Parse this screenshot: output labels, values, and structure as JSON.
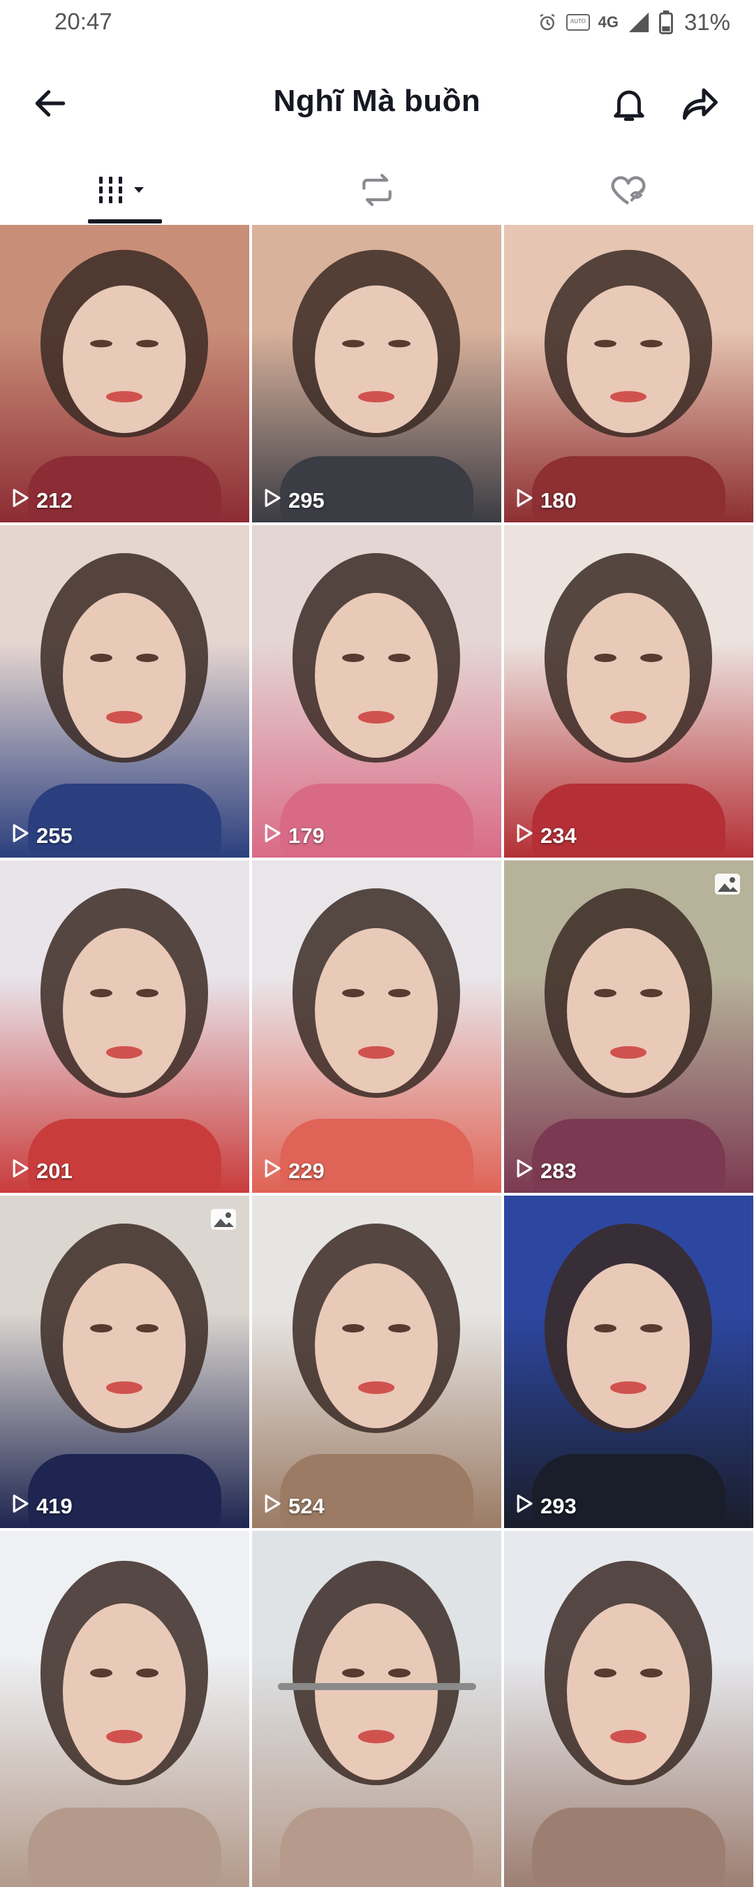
{
  "status": {
    "time": "20:47",
    "network": "4G",
    "auto_label": "AUTO",
    "battery": "31%"
  },
  "header": {
    "title": "Nghĩ Mà  buồn",
    "back_icon": "arrow-left-icon",
    "bell_icon": "bell-icon",
    "share_icon": "share-arrow-icon"
  },
  "tabs": [
    {
      "name": "videos",
      "icon": "grid-columns-icon",
      "selected": true
    },
    {
      "name": "reposts",
      "icon": "repost-icon",
      "selected": false
    },
    {
      "name": "liked",
      "icon": "hidden-heart-icon",
      "selected": false
    }
  ],
  "grid": {
    "items": [
      {
        "views": "212",
        "photo": false,
        "bg": "#8c2c34",
        "top": "#c98e78"
      },
      {
        "views": "295",
        "photo": false,
        "bg": "#3b3c44",
        "top": "#d9b29c"
      },
      {
        "views": "180",
        "photo": false,
        "bg": "#8d2f33",
        "top": "#e6c5b2"
      },
      {
        "views": "255",
        "photo": false,
        "bg": "#2b3f7e",
        "top": "#e6d6d0"
      },
      {
        "views": "179",
        "photo": false,
        "bg": "#d96a86",
        "top": "#e4d6d4"
      },
      {
        "views": "234",
        "photo": false,
        "bg": "#b43036",
        "top": "#ece3df"
      },
      {
        "views": "201",
        "photo": false,
        "bg": "#c93c3c",
        "top": "#e8e4ea"
      },
      {
        "views": "229",
        "photo": false,
        "bg": "#df6356",
        "top": "#e9e6ea"
      },
      {
        "views": "283",
        "photo": true,
        "bg": "#7c3a52",
        "top": "#b7b29a"
      },
      {
        "views": "419",
        "photo": true,
        "bg": "#1e2550",
        "top": "#dcd6d0"
      },
      {
        "views": "524",
        "photo": false,
        "bg": "#9b7b64",
        "top": "#e7e5e3"
      },
      {
        "views": "293",
        "photo": false,
        "bg": "#1a1d2a",
        "top": "#2d47a0"
      },
      {
        "views": "",
        "photo": false,
        "bg": "#b39a8b",
        "top": "#eef0f3"
      },
      {
        "views": "",
        "photo": false,
        "bg": "#b69b8c",
        "top": "#dfe3e6"
      },
      {
        "views": "",
        "photo": false,
        "bg": "#9d7f72",
        "top": "#e7e9ee"
      }
    ]
  }
}
